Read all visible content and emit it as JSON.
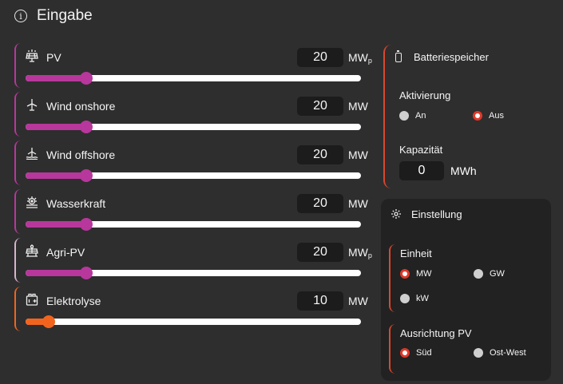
{
  "header": {
    "title": "Eingabe",
    "icon": "info-icon"
  },
  "sources": [
    {
      "label": "PV",
      "value": "20",
      "unit": "MW",
      "unit_sub": "p",
      "icon": "solar-panel-icon",
      "level": 0.18,
      "color": "#b8379c"
    },
    {
      "label": "Wind onshore",
      "value": "20",
      "unit": "MW",
      "unit_sub": "",
      "icon": "wind-turbine-icon",
      "level": 0.18,
      "color": "#b8379c"
    },
    {
      "label": "Wind offshore",
      "value": "20",
      "unit": "MW",
      "unit_sub": "",
      "icon": "offshore-wind-icon",
      "level": 0.18,
      "color": "#b8379c"
    },
    {
      "label": "Wasserkraft",
      "value": "20",
      "unit": "MW",
      "unit_sub": "",
      "icon": "hydro-icon",
      "level": 0.18,
      "color": "#b8379c"
    },
    {
      "label": "Agri-PV",
      "value": "20",
      "unit": "MW",
      "unit_sub": "p",
      "icon": "agri-pv-icon",
      "level": 0.18,
      "color": "#b8379c"
    },
    {
      "label": "Elektrolyse",
      "value": "10",
      "unit": "MW",
      "unit_sub": "",
      "icon": "electrolysis-icon",
      "level": 0.07,
      "color": "#f2641e"
    }
  ],
  "battery": {
    "title": "Batteriespeicher",
    "activation_label": "Aktivierung",
    "options": [
      "An",
      "Aus"
    ],
    "selected": "Aus",
    "capacity_label": "Kapazität",
    "capacity_value": "0",
    "capacity_unit": "MWh"
  },
  "settings": {
    "title": "Einstellung",
    "unit_label": "Einheit",
    "unit_options": [
      "MW",
      "GW",
      "kW"
    ],
    "unit_selected": "MW",
    "orientation_label": "Ausrichtung PV",
    "orientation_options": [
      "Süd",
      "Ost-West"
    ],
    "orientation_selected": "Süd"
  }
}
